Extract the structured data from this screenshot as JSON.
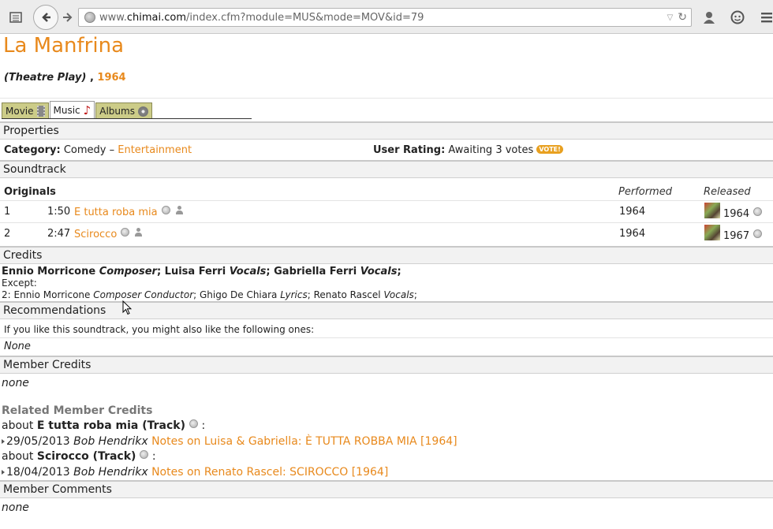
{
  "browser": {
    "url_prefix": "www.",
    "url_domain": "chimai.com",
    "url_path": "/index.cfm?module=MUS&mode=MOV&id=79"
  },
  "page": {
    "title": "La Manfrina",
    "type": "(Theatre Play)",
    "separator": ",",
    "year": "1964"
  },
  "tabs": [
    {
      "label": "Movie"
    },
    {
      "label": "Music"
    },
    {
      "label": "Albums"
    }
  ],
  "properties": {
    "heading": "Properties",
    "category_label": "Category",
    "category_value": "Comedy",
    "category_dash": "–",
    "category_link": "Entertainment",
    "rating_label": "User Rating",
    "rating_value": "Awaiting 3 votes",
    "vote_badge": "VOTE!"
  },
  "soundtrack": {
    "heading": "Soundtrack",
    "col_originals": "Originals",
    "col_performed": "Performed",
    "col_released": "Released",
    "tracks": [
      {
        "num": "1",
        "duration": "1:50",
        "title": "E tutta roba mia",
        "performed": "1964",
        "released": "1964"
      },
      {
        "num": "2",
        "duration": "2:47",
        "title": "Scirocco",
        "performed": "1964",
        "released": "1967"
      }
    ]
  },
  "credits": {
    "heading": "Credits",
    "main": [
      {
        "name": "Ennio Morricone",
        "role": "Composer"
      },
      {
        "name": "Luisa Ferri",
        "role": "Vocals"
      },
      {
        "name": "Gabriella Ferri",
        "role": "Vocals"
      }
    ],
    "except_label": "Except:",
    "except_line_prefix": "2:",
    "except": [
      {
        "name": "Ennio Morricone",
        "role": "Composer Conductor"
      },
      {
        "name": "Ghigo De Chiara",
        "role": "Lyrics"
      },
      {
        "name": "Renato Rascel",
        "role": "Vocals"
      }
    ]
  },
  "recommendations": {
    "heading": "Recommendations",
    "intro": "If you like this soundtrack, you might also like the following ones:",
    "value": "None"
  },
  "member_credits": {
    "heading": "Member Credits",
    "value": "none"
  },
  "related": {
    "heading": "Related Member Credits",
    "items": [
      {
        "about": "about",
        "subject": "E tutta roba mia (Track)",
        "colon": ":",
        "date": "29/05/2013",
        "author": "Bob Hendrikx",
        "link": "Notes on Luisa & Gabriella: È TUTTA ROBBA MIA [1964]"
      },
      {
        "about": "about",
        "subject": "Scirocco (Track)",
        "colon": ":",
        "date": "18/04/2013",
        "author": "Bob Hendrikx",
        "link": "Notes on Renato Rascel: SCIROCCO [1964]"
      }
    ]
  },
  "member_comments": {
    "heading": "Member Comments",
    "value": "none"
  },
  "icons": [
    "reader-icon",
    "back-icon",
    "forward-icon",
    "globe-icon",
    "dropdown-icon",
    "reload-icon",
    "account-icon",
    "chat-icon",
    "menu-icon",
    "film-icon",
    "music-note-icon",
    "disc-icon",
    "magnify-icon",
    "person-icon"
  ],
  "colors": {
    "accent": "#e8891c",
    "tab": "#cccc88"
  }
}
